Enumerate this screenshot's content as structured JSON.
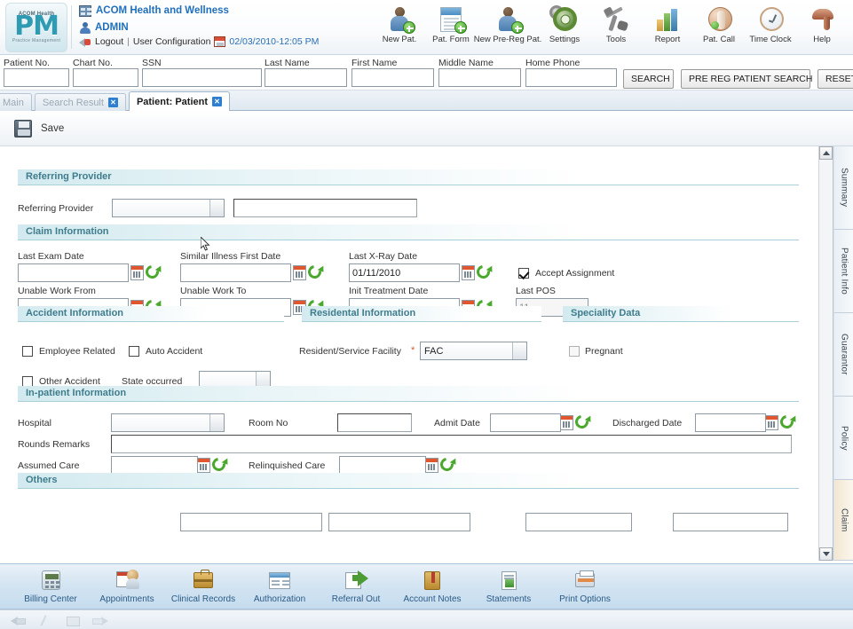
{
  "header": {
    "logo": {
      "brand": "ACOM Health",
      "abbr": "PM",
      "subtitle": "Practice Management"
    },
    "org_name": "ACOM Health and Wellness",
    "user_name": "ADMIN",
    "logout_label": "Logout",
    "separator": "|",
    "user_config_label": "User Configuration",
    "datetime": "02/03/2010-12:05 PM",
    "tools": [
      {
        "label": "New Pat.",
        "icon": "new-patient-icon"
      },
      {
        "label": "Pat. Form",
        "icon": "patient-form-icon"
      },
      {
        "label": "New Pre-Reg Pat.",
        "icon": "new-prereg-patient-icon"
      },
      {
        "label": "Settings",
        "icon": "gear-icon"
      },
      {
        "label": "Tools",
        "icon": "tools-icon"
      },
      {
        "label": "Report",
        "icon": "report-chart-icon"
      },
      {
        "label": "Pat. Call",
        "icon": "phone-icon"
      },
      {
        "label": "Time Clock",
        "icon": "clock-icon"
      },
      {
        "label": "Help",
        "icon": "help-icon"
      }
    ]
  },
  "search": {
    "fields": [
      {
        "label": "Patient No.",
        "value": "",
        "name": "patient-no-input"
      },
      {
        "label": "Chart No.",
        "value": "",
        "name": "chart-no-input"
      },
      {
        "label": "SSN",
        "value": "",
        "name": "ssn-input"
      },
      {
        "label": "Last Name",
        "value": "",
        "name": "last-name-input"
      },
      {
        "label": "First Name",
        "value": "",
        "name": "first-name-input"
      },
      {
        "label": "Middle Name",
        "value": "",
        "name": "middle-name-input"
      },
      {
        "label": "Home Phone",
        "value": "",
        "name": "home-phone-input"
      }
    ],
    "search_button": "SEARCH",
    "prereg_button": "PRE REG PATIENT SEARCH",
    "reset_button": "RESET"
  },
  "tabs": [
    {
      "label": "Main",
      "active": false,
      "closable": false
    },
    {
      "label": "Search Result",
      "active": false,
      "closable": true
    },
    {
      "label": "Patient: Patient",
      "active": true,
      "closable": true
    }
  ],
  "toolbar": {
    "save_label": "Save"
  },
  "sections": {
    "referring_provider": {
      "title": "Referring Provider",
      "field_label": "Referring Provider",
      "select_value": "",
      "text_value": ""
    },
    "claim_information": {
      "title": "Claim Information",
      "last_exam_date": {
        "label": "Last Exam Date",
        "value": ""
      },
      "similar_illness_first_date": {
        "label": "Similar Illness First Date",
        "value": ""
      },
      "last_xray_date": {
        "label": "Last X-Ray Date",
        "value": "01/11/2010"
      },
      "accept_assignment": {
        "label": "Accept Assignment",
        "checked": true
      },
      "unable_work_from": {
        "label": "Unable Work From",
        "value": ""
      },
      "unable_work_to": {
        "label": "Unable Work To",
        "value": ""
      },
      "init_treatment_date": {
        "label": "Init Treatment Date",
        "value": ""
      },
      "last_pos": {
        "label": "Last POS",
        "value": "11"
      }
    },
    "accident_information": {
      "title": "Accident Information",
      "employee_related": {
        "label": "Employee Related",
        "checked": false
      },
      "auto_accident": {
        "label": "Auto Accident",
        "checked": false
      },
      "other_accident": {
        "label": "Other Accident",
        "checked": false
      },
      "state_occurred": {
        "label": "State occurred",
        "value": ""
      }
    },
    "residental_information": {
      "title": "Residental Information",
      "facility": {
        "label": "Resident/Service Facility",
        "required": "*",
        "value": "FAC"
      }
    },
    "speciality_data": {
      "title": "Speciality Data",
      "pregnant": {
        "label": "Pregnant",
        "checked": false
      }
    },
    "inpatient_information": {
      "title": "In-patient Information",
      "hospital": {
        "label": "Hospital",
        "value": ""
      },
      "room_no": {
        "label": "Room No",
        "value": ""
      },
      "admit_date": {
        "label": "Admit Date",
        "value": ""
      },
      "discharged_date": {
        "label": "Discharged Date",
        "value": ""
      },
      "rounds_remarks": {
        "label": "Rounds Remarks",
        "value": ""
      },
      "assumed_care": {
        "label": "Assumed Care",
        "value": ""
      },
      "relinquished_care": {
        "label": "Relinquished Care",
        "value": ""
      }
    },
    "others": {
      "title": "Others"
    }
  },
  "side_tabs": [
    {
      "label": "Summary",
      "active": false
    },
    {
      "label": "Patient Info",
      "active": false
    },
    {
      "label": "Guarantor",
      "active": false
    },
    {
      "label": "Policy",
      "active": false
    },
    {
      "label": "Claim",
      "active": true
    }
  ],
  "dock": [
    {
      "label": "Billing Center",
      "icon": "cash-register-icon"
    },
    {
      "label": "Appointments",
      "icon": "calendar-person-icon"
    },
    {
      "label": "Clinical Records",
      "icon": "briefcase-icon"
    },
    {
      "label": "Authorization",
      "icon": "authorization-window-icon"
    },
    {
      "label": "Referral Out",
      "icon": "referral-arrow-icon"
    },
    {
      "label": "Account Notes",
      "icon": "notes-icon"
    },
    {
      "label": "Statements",
      "icon": "statement-document-icon"
    },
    {
      "label": "Print Options",
      "icon": "printer-icon"
    }
  ],
  "colors": {
    "accent_blue": "#1f6fbf",
    "section_teal": "#3f7c8c",
    "section_bg": "#d2eaef",
    "dock_bg": "#c5dcee",
    "required_red": "#d85a2a"
  }
}
